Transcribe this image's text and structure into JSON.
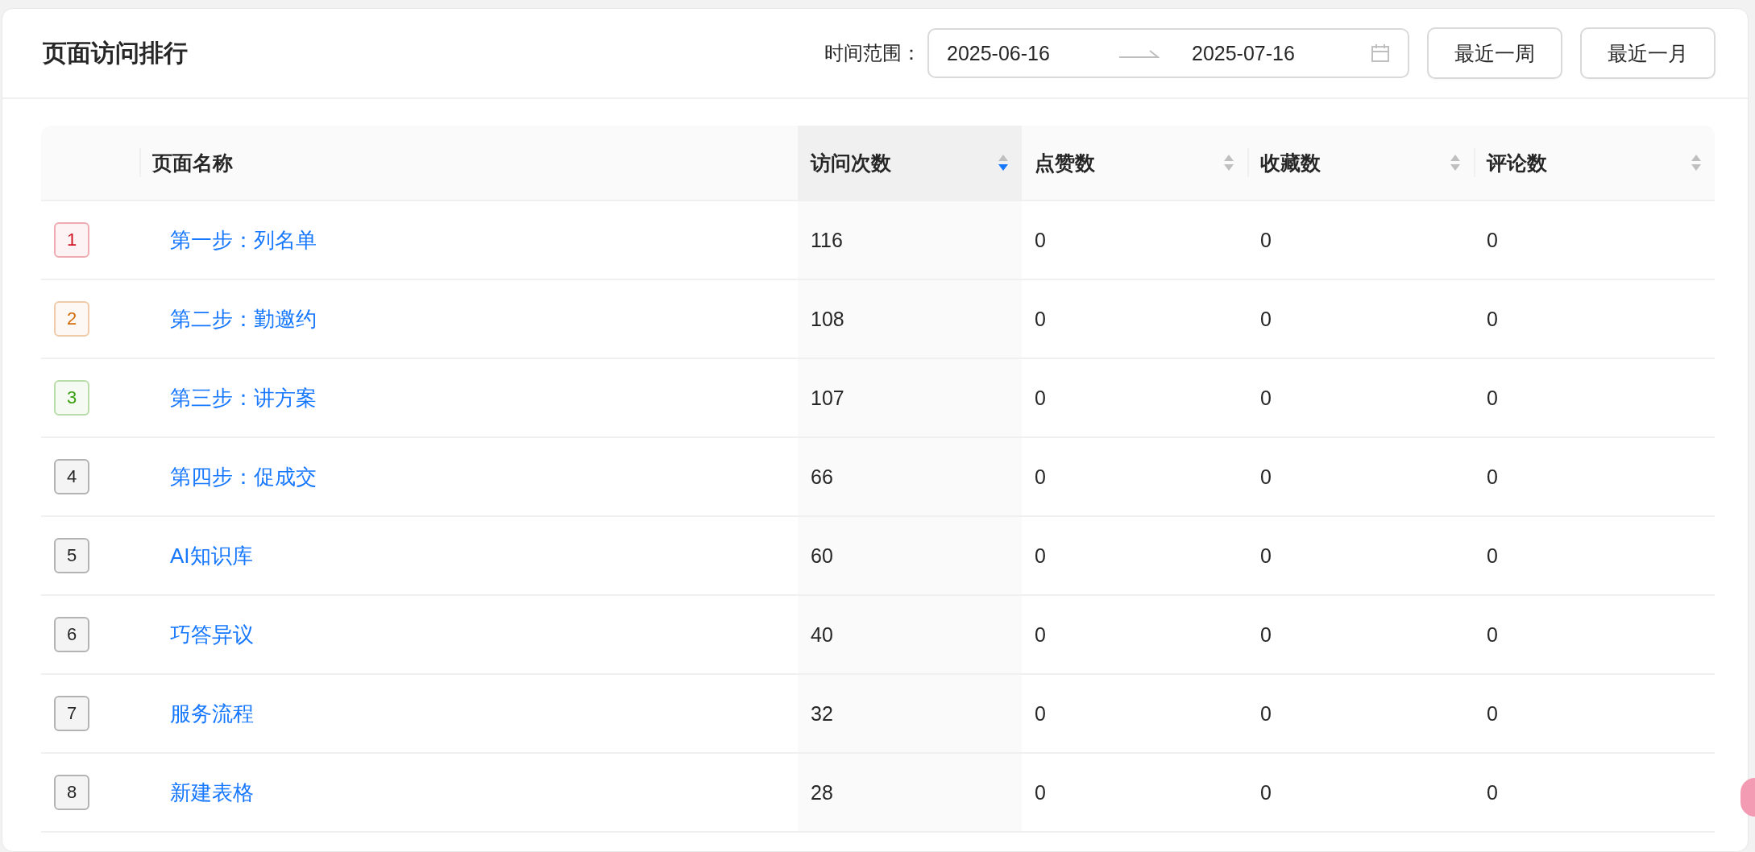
{
  "card": {
    "title": "页面访问排行"
  },
  "date_range": {
    "label": "时间范围：",
    "start": "2025-06-16",
    "end": "2025-07-16"
  },
  "buttons": [
    "最近一周",
    "最近一月"
  ],
  "table": {
    "columns": [
      {
        "sortable": false,
        "kind": "rank"
      },
      {
        "label": "页面名称",
        "sortable": false,
        "kind": "name"
      },
      {
        "label": "访问次数",
        "sortable": true,
        "sorted": true,
        "kind": "num"
      },
      {
        "label": "点赞数",
        "sortable": true,
        "sorted": false,
        "kind": "num"
      },
      {
        "label": "收藏数",
        "sortable": true,
        "sorted": false,
        "kind": "num"
      },
      {
        "label": "评论数",
        "sortable": true,
        "sorted": false,
        "kind": "num"
      }
    ],
    "rows": [
      {
        "rank": "1",
        "color": "#cf1322",
        "name": "第一步：列名单",
        "visits": "116",
        "likes": "0",
        "favorites": "0",
        "comments": "0"
      },
      {
        "rank": "2",
        "color": "#d46b08",
        "name": "第二步：勤邀约",
        "visits": "108",
        "likes": "0",
        "favorites": "0",
        "comments": "0"
      },
      {
        "rank": "3",
        "color": "#389e0d",
        "name": "第三步：讲方案",
        "visits": "107",
        "likes": "0",
        "favorites": "0",
        "comments": "0"
      },
      {
        "rank": "4",
        "color": "#262626",
        "name": "第四步：促成交",
        "visits": "66",
        "likes": "0",
        "favorites": "0",
        "comments": "0"
      },
      {
        "rank": "5",
        "color": "#262626",
        "name": "AI知识库",
        "visits": "60",
        "likes": "0",
        "favorites": "0",
        "comments": "0"
      },
      {
        "rank": "6",
        "color": "#262626",
        "name": "巧答异议",
        "visits": "40",
        "likes": "0",
        "favorites": "0",
        "comments": "0"
      },
      {
        "rank": "7",
        "color": "#262626",
        "name": "服务流程",
        "visits": "32",
        "likes": "0",
        "favorites": "0",
        "comments": "0"
      },
      {
        "rank": "8",
        "color": "#262626",
        "name": "新建表格",
        "visits": "28",
        "likes": "0",
        "favorites": "0",
        "comments": "0"
      }
    ]
  }
}
